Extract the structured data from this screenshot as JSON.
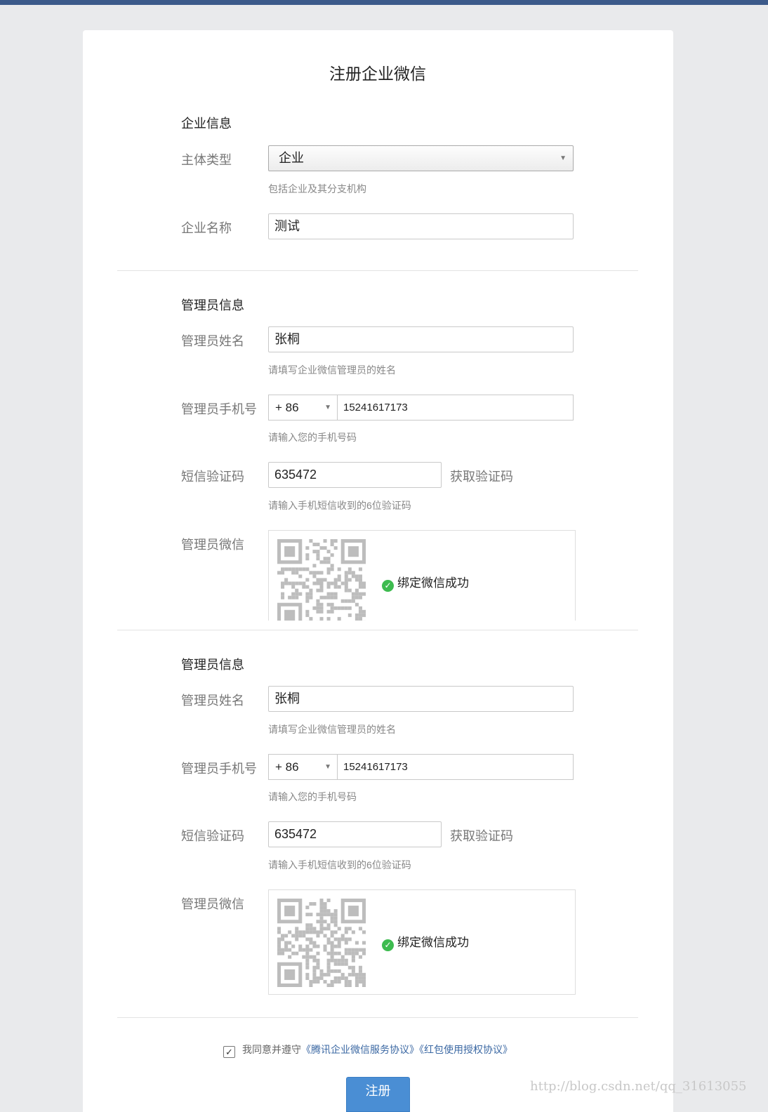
{
  "page": {
    "title": "注册企业微信",
    "submit_label": "注册",
    "watermark": "http://blog.csdn.net/qq_31613055"
  },
  "enterprise": {
    "section_title": "企业信息",
    "type_label": "主体类型",
    "type_value": "企业",
    "type_hint": "包括企业及其分支机构",
    "name_label": "企业名称",
    "name_value": "测试"
  },
  "admins": [
    {
      "section_title": "管理员信息",
      "name_label": "管理员姓名",
      "name_value": "张桐",
      "name_hint": "请填写企业微信管理员的姓名",
      "phone_label": "管理员手机号",
      "country_code": "+ 86",
      "phone_value": "15241617173",
      "phone_hint": "请输入您的手机号码",
      "sms_label": "短信验证码",
      "sms_value": "635472",
      "get_code_label": "获取验证码",
      "sms_hint": "请输入手机短信收到的6位验证码",
      "wechat_label": "管理员微信",
      "bound_text": "绑定微信成功"
    },
    {
      "section_title": "管理员信息",
      "name_label": "管理员姓名",
      "name_value": "张桐",
      "name_hint": "请填写企业微信管理员的姓名",
      "phone_label": "管理员手机号",
      "country_code": "+ 86",
      "phone_value": "15241617173",
      "phone_hint": "请输入您的手机号码",
      "sms_label": "短信验证码",
      "sms_value": "635472",
      "get_code_label": "获取验证码",
      "sms_hint": "请输入手机短信收到的6位验证码",
      "wechat_label": "管理员微信",
      "bound_text": "绑定微信成功"
    }
  ],
  "agreement": {
    "prefix": "我同意并遵守",
    "link1": "《腾讯企业微信服务协议》",
    "link2": "《红包使用授权协议》",
    "checked": true
  },
  "colors": {
    "accent": "#4a8ed4",
    "link": "#3b68a3",
    "success": "#3dbb4f",
    "topbar": "#3c5a8a"
  }
}
